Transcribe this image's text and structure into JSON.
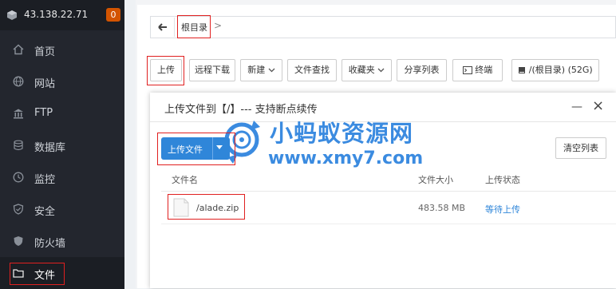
{
  "sidebar": {
    "ip": "43.138.22.71",
    "badge": "0",
    "items": [
      {
        "label": "首页",
        "icon": "home-icon"
      },
      {
        "label": "网站",
        "icon": "globe-icon"
      },
      {
        "label": "FTP",
        "icon": "ftp-icon"
      },
      {
        "label": "数据库",
        "icon": "database-icon"
      },
      {
        "label": "监控",
        "icon": "monitor-icon"
      },
      {
        "label": "安全",
        "icon": "shield-icon"
      },
      {
        "label": "防火墙",
        "icon": "firewall-icon"
      },
      {
        "label": "文件",
        "icon": "folder-icon",
        "active": true
      }
    ]
  },
  "path": {
    "crumb": "根目录",
    "sep": ">"
  },
  "toolbar": {
    "upload": "上传",
    "remote_download": "远程下载",
    "new": "新建",
    "file_search": "文件查找",
    "favorites": "收藏夹",
    "share_list": "分享列表",
    "terminal": "终端",
    "disk": "/(根目录) (52G)"
  },
  "modal": {
    "title": "上传文件到【/】--- 支持断点续传",
    "min_icon": "minimize-icon",
    "close_icon": "close-icon",
    "upload_file": "上传文件",
    "clear_list": "清空列表",
    "columns": {
      "name": "文件名",
      "size": "文件大小",
      "status": "上传状态"
    },
    "files": [
      {
        "name": "/alade.zip",
        "size": "483.58 MB",
        "status": "等待上传"
      }
    ]
  },
  "watermark": {
    "title": "小蚂蚁资源网",
    "url": "www.xmy7.com"
  },
  "colors": {
    "sidebar_bg": "#23262e",
    "accent": "#2f86d9",
    "badge": "#d35400",
    "highlight": "#e02020"
  }
}
